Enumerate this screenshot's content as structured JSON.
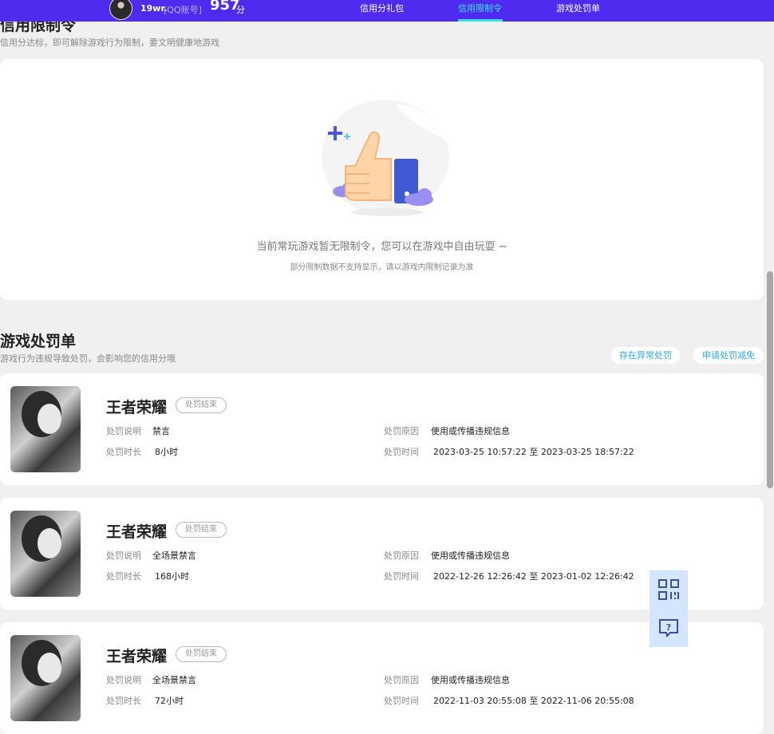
{
  "header": {
    "nickname": "19wr.",
    "account_type": "[QQ账号]",
    "score": "957",
    "score_unit": "分",
    "nav": [
      "信用分礼包",
      "信用限制令",
      "游戏处罚单"
    ]
  },
  "restriction": {
    "title": "信用限制令",
    "subtitle": "信用分达标，即可解除游戏行为限制，要文明健康地游戏",
    "empty_message": "当前常玩游戏暂无限制令，您可以在游戏中自由玩耍 ~",
    "empty_note": "部分限制数据不支持显示，请以游戏内限制记录为准"
  },
  "penalty": {
    "title": "游戏处罚单",
    "subtitle": "游戏行为违规导致处罚，会影响您的信用分哦",
    "buttons": [
      "存在异常处罚",
      "申请处罚减免"
    ],
    "labels": {
      "desc": "处罚说明",
      "duration": "处罚时长",
      "reason": "处罚原因",
      "time": "处罚时间"
    },
    "records": [
      {
        "game": "王者荣耀",
        "status": "处罚结束",
        "desc": "禁言",
        "duration": "8小时",
        "reason": "使用或传播违规信息",
        "time": "2023-03-25 10:57:22 至 2023-03-25 18:57:22"
      },
      {
        "game": "王者荣耀",
        "status": "处罚结束",
        "desc": "全场景禁言",
        "duration": "168小时",
        "reason": "使用或传播违规信息",
        "time": "2022-12-26 12:26:42 至 2023-01-02 12:26:42"
      },
      {
        "game": "王者荣耀",
        "status": "处罚结束",
        "desc": "全场景禁言",
        "duration": "72小时",
        "reason": "使用或传播违规信息",
        "time": "2022-11-03 20:55:08 至 2022-11-06 20:55:08"
      }
    ]
  },
  "icons": [
    "qr-code-icon",
    "help-chat-icon",
    "thumbs-up-illustration"
  ],
  "colors": {
    "brand": "#4f2bf0",
    "accent": "#37e2e6",
    "link": "#2fa8e6"
  }
}
